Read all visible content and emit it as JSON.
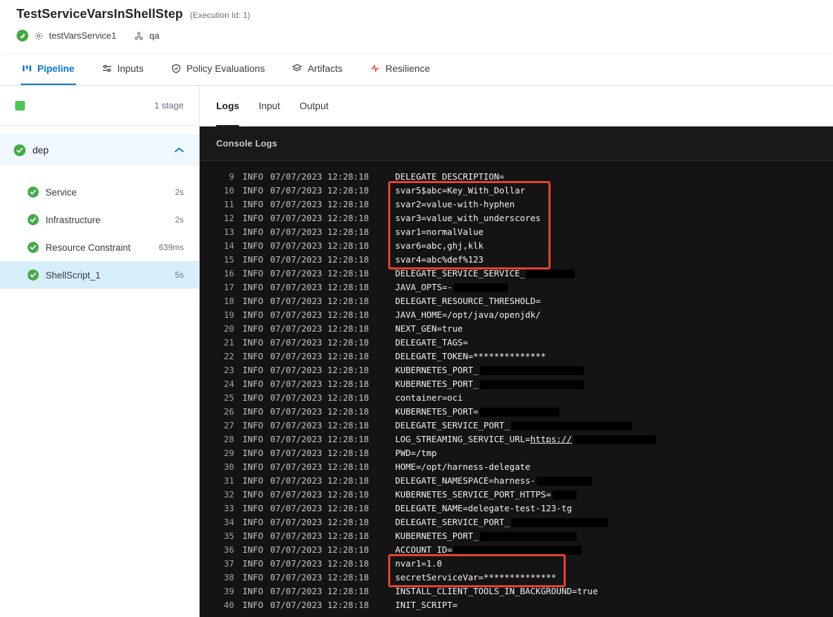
{
  "colors": {
    "accent": "#0278d5",
    "success": "#42ab45",
    "highlight": "#e8432d"
  },
  "header": {
    "title": "TestServiceVarsInShellStep",
    "execution_id": "(Execution Id: 1)",
    "service_label": "testVarsService1",
    "env_label": "qa"
  },
  "nav_tabs": [
    {
      "label": "Pipeline",
      "icon": "pipeline-icon",
      "active": true
    },
    {
      "label": "Inputs",
      "icon": "inputs-icon",
      "active": false
    },
    {
      "label": "Policy Evaluations",
      "icon": "policy-evaluations-icon",
      "active": false
    },
    {
      "label": "Artifacts",
      "icon": "artifacts-icon",
      "active": false
    },
    {
      "label": "Resilience",
      "icon": "resilience-icon",
      "active": false
    }
  ],
  "sidebar": {
    "stage_count": "1 stage",
    "stage_name": "dep",
    "steps": [
      {
        "label": "Service",
        "duration": "2s",
        "selected": false
      },
      {
        "label": "Infrastructure",
        "duration": "2s",
        "selected": false
      },
      {
        "label": "Resource Constraint",
        "duration": "639ms",
        "selected": false
      },
      {
        "label": "ShellScript_1",
        "duration": "5s",
        "selected": true
      }
    ]
  },
  "log_panel": {
    "tabs": [
      {
        "label": "Logs",
        "active": true
      },
      {
        "label": "Input",
        "active": false
      },
      {
        "label": "Output",
        "active": false
      }
    ],
    "console_title": "Console Logs",
    "level": "INFO",
    "timestamp": "07/07/2023 12:28:18",
    "rows": [
      {
        "num": 9,
        "msg": "DELEGATE_DESCRIPTION=",
        "redact": 0,
        "hl": 0
      },
      {
        "num": 10,
        "msg": "svar5$abc=Key_With_Dollar",
        "redact": 0,
        "hl": 1
      },
      {
        "num": 11,
        "msg": "svar2=value-with-hyphen",
        "redact": 0,
        "hl": 1
      },
      {
        "num": 12,
        "msg": "svar3=value_with_underscores",
        "redact": 0,
        "hl": 1
      },
      {
        "num": 13,
        "msg": "svar1=normalValue",
        "redact": 0,
        "hl": 1
      },
      {
        "num": 14,
        "msg": "svar6=abc,ghj,klk",
        "redact": 0,
        "hl": 1
      },
      {
        "num": 15,
        "msg": "svar4=abc%def%123",
        "redact": 0,
        "hl": 1
      },
      {
        "num": 16,
        "msg": "DELEGATE_SERVICE_SERVICE_",
        "redact": 70,
        "hl": 0
      },
      {
        "num": 17,
        "msg": "JAVA_OPTS=-",
        "redact": 78,
        "hl": 0
      },
      {
        "num": 18,
        "msg": "DELEGATE_RESOURCE_THRESHOLD=",
        "redact": 0,
        "hl": 0
      },
      {
        "num": 19,
        "msg": "JAVA_HOME=/opt/java/openjdk/",
        "redact": 0,
        "hl": 0
      },
      {
        "num": 20,
        "msg": "NEXT_GEN=true",
        "redact": 0,
        "hl": 0
      },
      {
        "num": 21,
        "msg": "DELEGATE_TAGS=",
        "redact": 0,
        "hl": 0
      },
      {
        "num": 22,
        "msg": "DELEGATE_TOKEN=**************",
        "redact": 0,
        "hl": 0
      },
      {
        "num": 23,
        "msg": "KUBERNETES_PORT_",
        "redact": 150,
        "hl": 0
      },
      {
        "num": 24,
        "msg": "KUBERNETES_PORT_",
        "redact": 150,
        "hl": 0
      },
      {
        "num": 25,
        "msg": "container=oci",
        "redact": 0,
        "hl": 0
      },
      {
        "num": 26,
        "msg": "KUBERNETES_PORT=",
        "redact": 115,
        "hl": 0
      },
      {
        "num": 27,
        "msg": "DELEGATE_SERVICE_PORT_",
        "redact": 175,
        "hl": 0
      },
      {
        "num": 28,
        "msg": "LOG_STREAMING_SERVICE_URL=",
        "link": "https://",
        "redact": 120,
        "hl": 0
      },
      {
        "num": 29,
        "msg": "PWD=/tmp",
        "redact": 0,
        "hl": 0
      },
      {
        "num": 30,
        "msg": "HOME=/opt/harness-delegate",
        "redact": 0,
        "hl": 0
      },
      {
        "num": 31,
        "msg": "DELEGATE_NAMESPACE=harness-",
        "redact": 80,
        "hl": 0
      },
      {
        "num": 32,
        "msg": "KUBERNETES_SERVICE_PORT_HTTPS=",
        "redact": 35,
        "hl": 0
      },
      {
        "num": 33,
        "msg": "DELEGATE_NAME=delegate-test-123-tg",
        "redact": 0,
        "hl": 0
      },
      {
        "num": 34,
        "msg": "DELEGATE_SERVICE_PORT_",
        "redact": 140,
        "hl": 0
      },
      {
        "num": 35,
        "msg": "KUBERNETES_PORT_",
        "redact": 140,
        "hl": 0
      },
      {
        "num": 36,
        "msg": "ACCOUNT_ID=",
        "redact": 185,
        "hl": 0
      },
      {
        "num": 37,
        "msg": "nvar1=1.0",
        "redact": 0,
        "hl": 2
      },
      {
        "num": 38,
        "msg": "secretServiceVar=**************",
        "redact": 0,
        "hl": 2
      },
      {
        "num": 39,
        "msg": "INSTALL_CLIENT_TOOLS_IN_BACKGROUND=true",
        "redact": 0,
        "hl": 0
      },
      {
        "num": 40,
        "msg": "INIT_SCRIPT=",
        "redact": 0,
        "hl": 0
      }
    ]
  }
}
